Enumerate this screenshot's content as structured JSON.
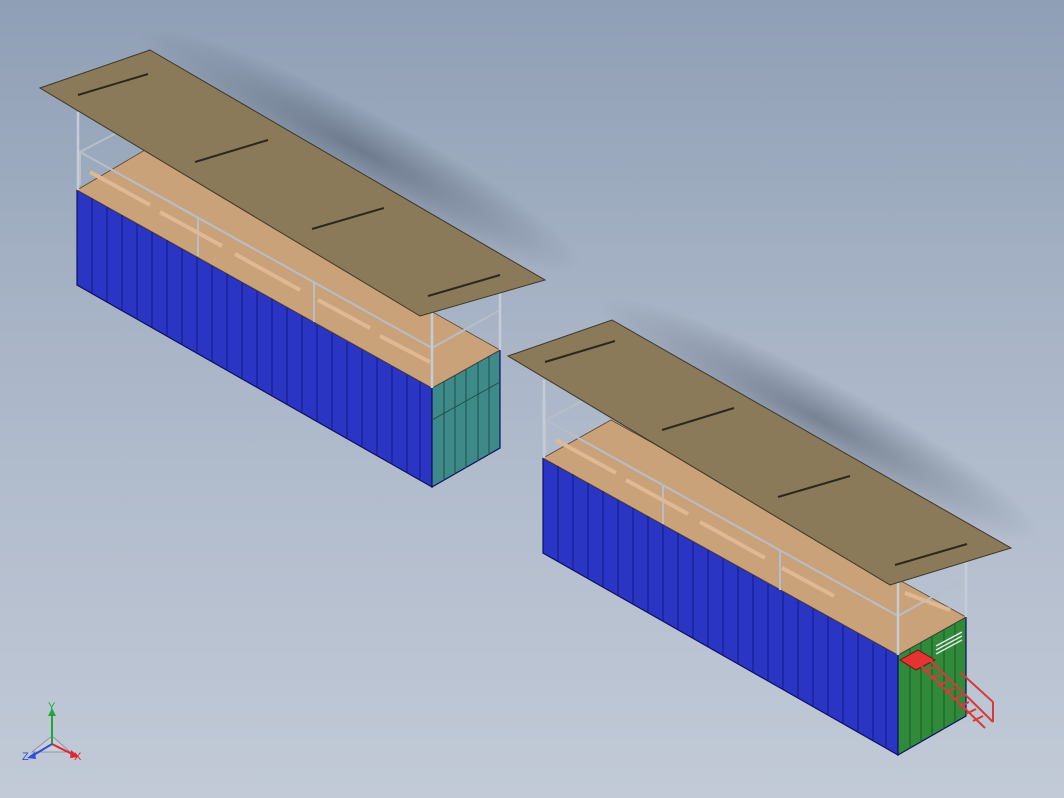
{
  "viewport": {
    "background_top": "#8f9fb5",
    "background_bottom": "#c2cad7"
  },
  "colors": {
    "container_blue": "#2a35c4",
    "container_dark": "#1a2190",
    "roof": "#8a7a5a",
    "deck": "#c9a27a",
    "door_teal": "#3d8a88",
    "door_green": "#2f8a3a",
    "stair_red": "#d63a3a",
    "rail_gray": "#9aa2ad"
  },
  "triad": {
    "x_label": "X",
    "y_label": "Y",
    "z_label": "Z",
    "x_color": "#e0252b",
    "y_color": "#1fa83a",
    "z_color": "#2f4fd8"
  },
  "models": [
    {
      "name": "container-unit-left",
      "door": "teal"
    },
    {
      "name": "container-unit-right",
      "door": "green",
      "stairs": true
    }
  ]
}
